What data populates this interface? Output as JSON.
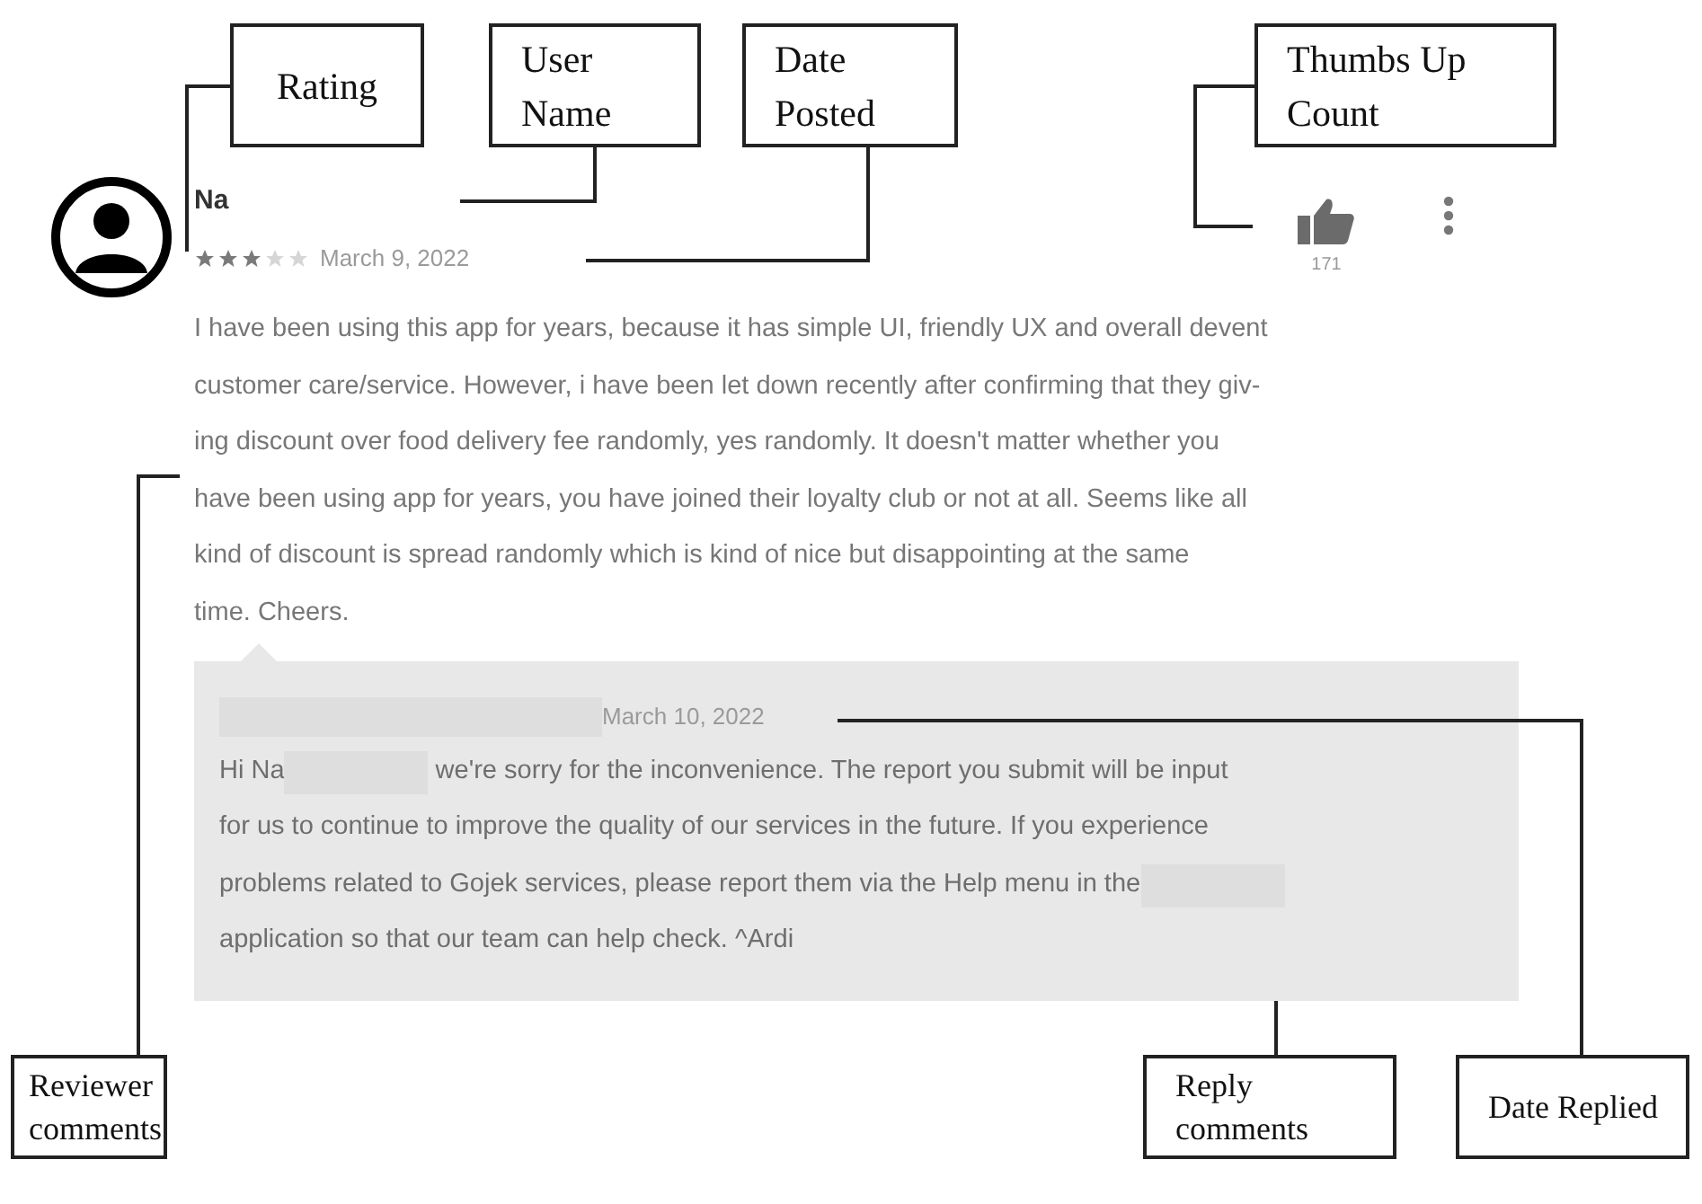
{
  "review": {
    "user_name": "Na",
    "stars": 3,
    "date": "March 9, 2022",
    "thumbs_up_count": "171",
    "comment_lines": [
      "I have been using this app for years, because it has simple UI, friendly UX and overall devent",
      "customer care/service. However, i have been let down recently after confirming that they giv-",
      "ing discount over food delivery fee randomly, yes randomly. It doesn't matter whether you",
      "have been using app for years, you have joined their loyalty club or not at all. Seems like all",
      "kind of discount is spread randomly which is kind of nice but disappointing at the same",
      "time. Cheers."
    ]
  },
  "reply": {
    "date": "March 10, 2022",
    "lines": [
      [
        {
          "kind": "text",
          "text": "Hi Na"
        },
        {
          "kind": "redaction"
        },
        {
          "kind": "text",
          "text": " we're sorry for the inconvenience. The report you submit will be input"
        }
      ],
      [
        {
          "kind": "text",
          "text": "for us to continue to improve the quality of our services in the future. If you experience"
        }
      ],
      [
        {
          "kind": "text",
          "text": "problems related to Gojek services, please report them via the Help menu in the"
        },
        {
          "kind": "redaction"
        }
      ],
      [
        {
          "kind": "text",
          "text": "application so that our team can help check. ^Ardi"
        }
      ]
    ]
  },
  "callouts": [
    {
      "text": "Rating"
    },
    {
      "text": "User Name"
    },
    {
      "text": "Date Posted"
    },
    {
      "text": "Thumbs Up Count"
    },
    {
      "text": "Reviewer comments"
    },
    {
      "text": "Reply comments"
    },
    {
      "text": "Date Replied"
    }
  ]
}
